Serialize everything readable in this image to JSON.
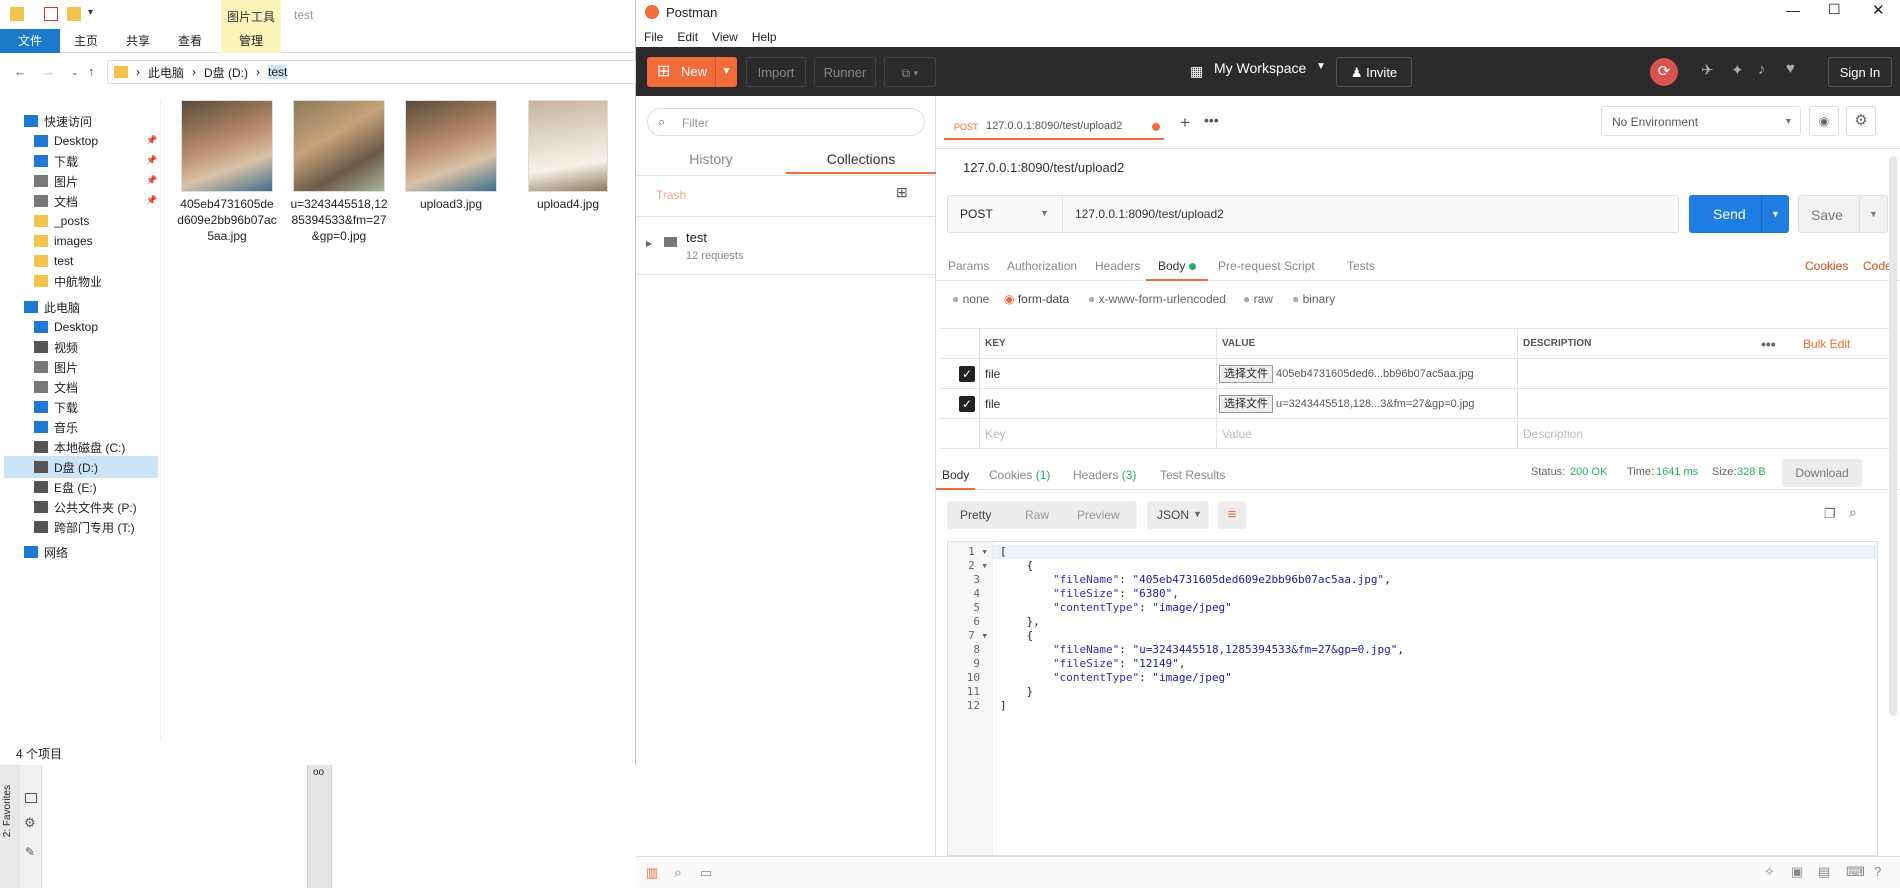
{
  "explorer": {
    "ribbon_tools_label": "图片工具",
    "window_title": "test",
    "tabs": [
      "文件",
      "主页",
      "共享",
      "查看",
      "管理"
    ],
    "address": [
      "此电脑",
      "D盘 (D:)",
      "test"
    ],
    "nav": [
      {
        "label": "快速访问",
        "pin": false
      },
      {
        "label": "Desktop",
        "pin": true
      },
      {
        "label": "下载",
        "pin": true
      },
      {
        "label": "图片",
        "pin": true
      },
      {
        "label": "文档",
        "pin": true
      },
      {
        "label": "_posts",
        "pin": false
      },
      {
        "label": "images",
        "pin": false
      },
      {
        "label": "test",
        "pin": false
      },
      {
        "label": "中航物业",
        "pin": false
      },
      {
        "label": "此电脑",
        "pin": false
      },
      {
        "label": "Desktop",
        "pin": false
      },
      {
        "label": "视频",
        "pin": false
      },
      {
        "label": "图片",
        "pin": false
      },
      {
        "label": "文档",
        "pin": false
      },
      {
        "label": "下载",
        "pin": false
      },
      {
        "label": "音乐",
        "pin": false
      },
      {
        "label": "本地磁盘 (C:)",
        "pin": false
      },
      {
        "label": "D盘 (D:)",
        "pin": false
      },
      {
        "label": "E盘 (E:)",
        "pin": false
      },
      {
        "label": "公共文件夹 (P:)",
        "pin": false
      },
      {
        "label": "跨部门专用 (T:)",
        "pin": false
      },
      {
        "label": "网络",
        "pin": false
      }
    ],
    "files": [
      "405eb4731605ded609e2bb96b07ac5aa.jpg",
      "u=3243445518,1285394533&fm=27&gp=0.jpg",
      "upload3.jpg",
      "upload4.jpg"
    ],
    "status": "4 个项目",
    "ide_side_label": "2: Favorites"
  },
  "postman": {
    "title": "Postman",
    "menu": [
      "File",
      "Edit",
      "View",
      "Help"
    ],
    "toolbar": {
      "new": "New",
      "import": "Import",
      "runner": "Runner",
      "workspace": "My Workspace",
      "invite": "Invite",
      "signin": "Sign In"
    },
    "sidebar": {
      "filter_placeholder": "Filter",
      "tab_history": "History",
      "tab_collections": "Collections",
      "trash": "Trash",
      "collection_name": "test",
      "collection_count": "12 requests"
    },
    "request_tab": {
      "method": "POST",
      "url": "127.0.0.1:8090/test/upload2"
    },
    "environment": "No Environment",
    "request_name": "127.0.0.1:8090/test/upload2",
    "method": "POST",
    "url": "127.0.0.1:8090/test/upload2",
    "send": "Send",
    "save": "Save",
    "req_tabs": [
      "Params",
      "Authorization",
      "Headers",
      "Body",
      "Pre-request Script",
      "Tests"
    ],
    "cookies_link": "Cookies",
    "code_link": "Code",
    "body_modes": [
      "none",
      "form-data",
      "x-www-form-urlencoded",
      "raw",
      "binary"
    ],
    "kv_headers": {
      "key": "KEY",
      "value": "VALUE",
      "desc": "DESCRIPTION",
      "bulk": "Bulk Edit"
    },
    "kv_rows": [
      {
        "key": "file",
        "choose": "选择文件",
        "value": "405eb4731605ded6...bb96b07ac5aa.jpg"
      },
      {
        "key": "file",
        "choose": "选择文件",
        "value": "u=3243445518,128...3&fm=27&gp=0.jpg"
      }
    ],
    "kv_placeholders": {
      "key": "Key",
      "value": "Value",
      "desc": "Description"
    },
    "resp_tabs": {
      "body": "Body",
      "cookies": "Cookies",
      "cookies_n": "(1)",
      "headers": "Headers",
      "headers_n": "(3)",
      "tests": "Test Results"
    },
    "status": {
      "status_label": "Status:",
      "status": "200 OK",
      "time_label": "Time:",
      "time": "1641 ms",
      "size_label": "Size:",
      "size": "328 B"
    },
    "download": "Download",
    "view_modes": [
      "Pretty",
      "Raw",
      "Preview"
    ],
    "format": "JSON",
    "code_lines": [
      "[",
      "    {",
      "        \"fileName\": \"405eb4731605ded609e2bb96b07ac5aa.jpg\",",
      "        \"fileSize\": \"6380\",",
      "        \"contentType\": \"image/jpeg\"",
      "    },",
      "    {",
      "        \"fileName\": \"u=3243445518,1285394533&fm=27&gp=0.jpg\",",
      "        \"fileSize\": \"12149\",",
      "        \"contentType\": \"image/jpeg\"",
      "    }",
      "]"
    ],
    "line_numbers": [
      "1",
      "2",
      "3",
      "4",
      "5",
      "6",
      "7",
      "8",
      "9",
      "10",
      "11",
      "12"
    ]
  }
}
